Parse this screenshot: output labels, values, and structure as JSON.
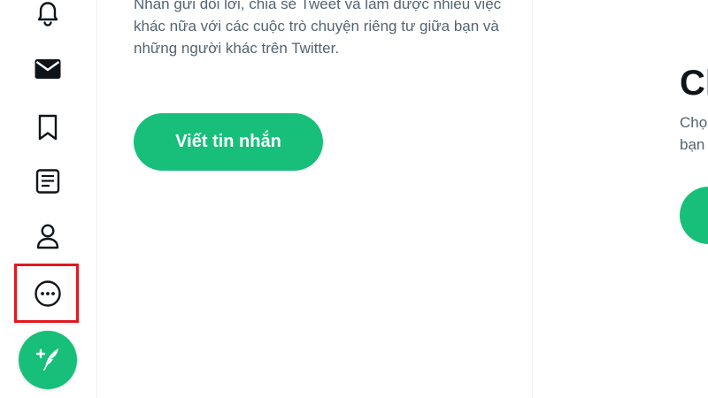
{
  "sidebar": {
    "icons": [
      {
        "name": "notifications",
        "icon": "bell-icon"
      },
      {
        "name": "messages",
        "icon": "envelope-icon"
      },
      {
        "name": "bookmarks",
        "icon": "bookmark-icon"
      },
      {
        "name": "lists",
        "icon": "list-icon"
      },
      {
        "name": "profile",
        "icon": "person-icon"
      },
      {
        "name": "more",
        "icon": "more-circle-icon"
      }
    ],
    "fab_icon": "feather-plus-icon"
  },
  "messages_panel": {
    "description": "Nhắn gửi đổi lời, chia sẻ Tweet và làm được nhiều việc khác nữa với các cuộc trò chuyện riêng tư giữa bạn và những người khác trên Twitter.",
    "write_button": "Viết tin nhắn"
  },
  "right_panel": {
    "title": "Ch",
    "description_line1": "Chọ",
    "description_line2": "bạn"
  },
  "colors": {
    "accent": "#17bf7b",
    "highlight": "#e0191f",
    "text_secondary": "#536471",
    "text_primary": "#0f1419"
  }
}
